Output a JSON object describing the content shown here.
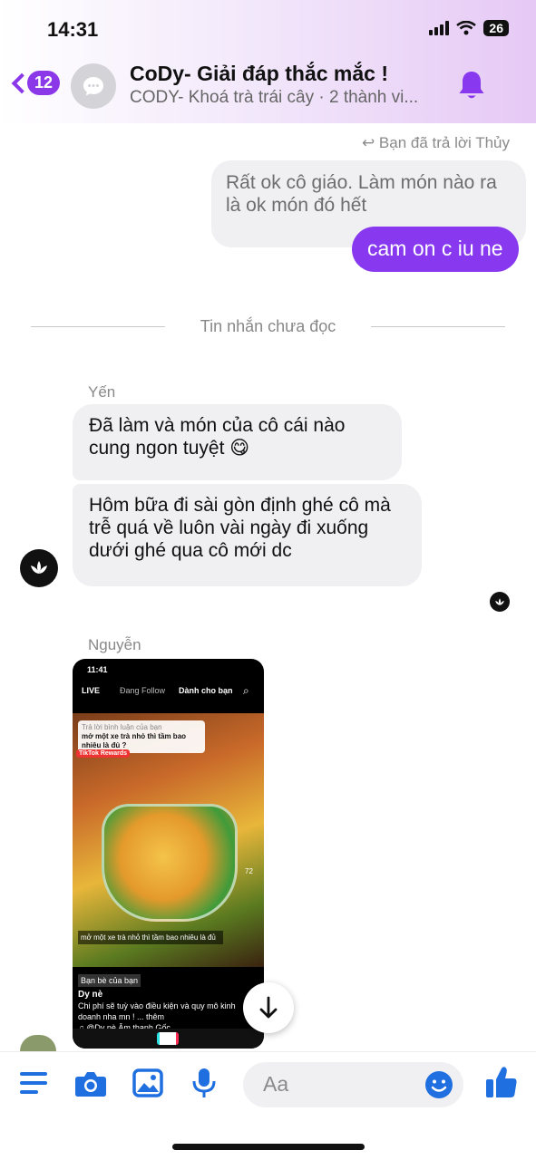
{
  "status_bar": {
    "time": "14:31",
    "battery": "26"
  },
  "header": {
    "back_count": "12",
    "title": "CoDy- Giải đáp thắc mắc !",
    "subtitle": "CODY- Khoá trà trái cây · 2 thành vi..."
  },
  "messages": {
    "reply_note": "Bạn đã trả lời Thủy",
    "quoted_text": "Rất ok cô giáo. Làm món nào ra là ok món đó hết",
    "my_message": "cam on c iu ne",
    "unread_divider": "Tin nhắn chưa đọc",
    "sender_1": "Yến",
    "in_message_1": "Đã làm và món của cô cái nào cung ngon tuyệt 😋",
    "in_message_2": "Hôm bữa đi sài gòn định ghé cô mà trễ quá về luôn vài ngày đi xuống dưới ghé qua cô mới dc",
    "sender_2": "Nguyễn"
  },
  "shared_screenshot": {
    "time": "11:41",
    "tab_following": "Đang Follow",
    "tab_for_you": "Dành cho bạn",
    "comment_reply": "Trả lời bình luận của bạn",
    "overlay_question": "mở một xe trà nhỏ thì tầm bao nhiêu là đủ ?",
    "rewards": "TikTok Rewards",
    "search_caption": "mở một xe trà nhỏ thì tầm bao nhiêu là đủ",
    "friends_label": "Bạn bè của bạn",
    "author": "Dy nè",
    "description": "Chi phí sẽ tuỳ vào điều kiện và quy mô kinh doanh nha mn ! ... thêm",
    "sound": "♫ @Dy nè Âm thanh Gốc",
    "likes": "72"
  },
  "composer": {
    "placeholder": "Aa"
  },
  "colors": {
    "accent": "#8839ef",
    "bubble_gray": "#f0f0f2",
    "tool_blue": "#1f6fe0"
  },
  "icons": [
    "back-chevron-icon",
    "group-chat-icon",
    "bell-icon",
    "menu-icon",
    "camera-icon",
    "gallery-icon",
    "microphone-icon",
    "emoji-icon",
    "like-thumb-icon",
    "arrow-down-icon"
  ]
}
